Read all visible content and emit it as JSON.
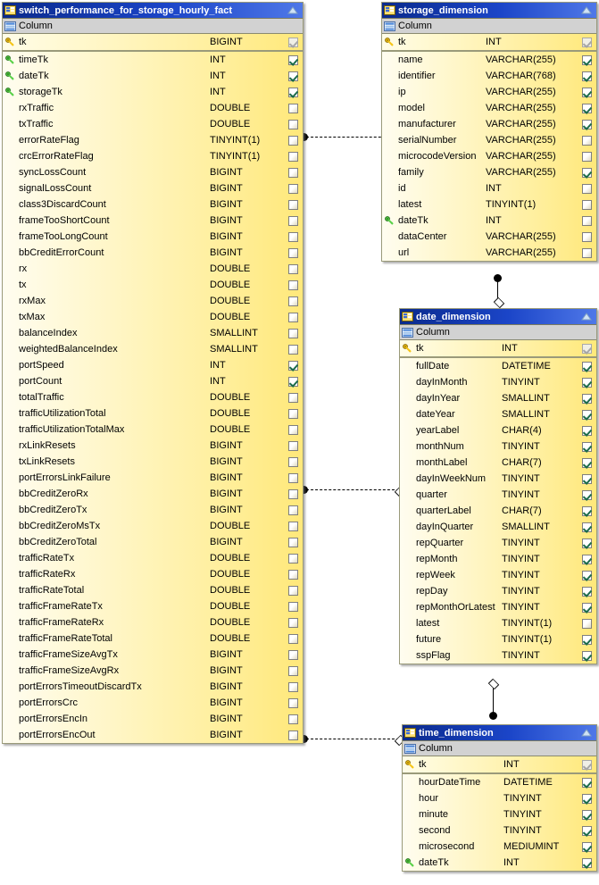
{
  "meta": {
    "column_header": "Column",
    "key_icon_pk": "gold-key-icon",
    "key_icon_fk": "green-key-icon",
    "table_icon": "table-icon",
    "collapse_icon": "collapse-triangle-icon",
    "accent_title": "#1b45c8",
    "row_fill": "#ffef9e",
    "check_color": "#1b6b4a"
  },
  "tables": [
    {
      "id": "fact",
      "name": "switch_performance_for_storage_hourly_fact",
      "pk": {
        "name": "tk",
        "type": "BIGINT",
        "key": "pk",
        "checked": true,
        "disabled": true
      },
      "columns": [
        {
          "name": "timeTk",
          "type": "INT",
          "key": "fk",
          "checked": true
        },
        {
          "name": "dateTk",
          "type": "INT",
          "key": "fk",
          "checked": true
        },
        {
          "name": "storageTk",
          "type": "INT",
          "key": "fk",
          "checked": true
        },
        {
          "name": "rxTraffic",
          "type": "DOUBLE",
          "key": "",
          "checked": false
        },
        {
          "name": "txTraffic",
          "type": "DOUBLE",
          "key": "",
          "checked": false
        },
        {
          "name": "errorRateFlag",
          "type": "TINYINT(1)",
          "key": "",
          "checked": false
        },
        {
          "name": "crcErrorRateFlag",
          "type": "TINYINT(1)",
          "key": "",
          "checked": false
        },
        {
          "name": "syncLossCount",
          "type": "BIGINT",
          "key": "",
          "checked": false
        },
        {
          "name": "signalLossCount",
          "type": "BIGINT",
          "key": "",
          "checked": false
        },
        {
          "name": "class3DiscardCount",
          "type": "BIGINT",
          "key": "",
          "checked": false
        },
        {
          "name": "frameTooShortCount",
          "type": "BIGINT",
          "key": "",
          "checked": false
        },
        {
          "name": "frameTooLongCount",
          "type": "BIGINT",
          "key": "",
          "checked": false
        },
        {
          "name": "bbCreditErrorCount",
          "type": "BIGINT",
          "key": "",
          "checked": false
        },
        {
          "name": "rx",
          "type": "DOUBLE",
          "key": "",
          "checked": false
        },
        {
          "name": "tx",
          "type": "DOUBLE",
          "key": "",
          "checked": false
        },
        {
          "name": "rxMax",
          "type": "DOUBLE",
          "key": "",
          "checked": false
        },
        {
          "name": "txMax",
          "type": "DOUBLE",
          "key": "",
          "checked": false
        },
        {
          "name": "balanceIndex",
          "type": "SMALLINT",
          "key": "",
          "checked": false
        },
        {
          "name": "weightedBalanceIndex",
          "type": "SMALLINT",
          "key": "",
          "checked": false
        },
        {
          "name": "portSpeed",
          "type": "INT",
          "key": "",
          "checked": true
        },
        {
          "name": "portCount",
          "type": "INT",
          "key": "",
          "checked": true
        },
        {
          "name": "totalTraffic",
          "type": "DOUBLE",
          "key": "",
          "checked": false
        },
        {
          "name": "trafficUtilizationTotal",
          "type": "DOUBLE",
          "key": "",
          "checked": false
        },
        {
          "name": "trafficUtilizationTotalMax",
          "type": "DOUBLE",
          "key": "",
          "checked": false
        },
        {
          "name": "rxLinkResets",
          "type": "BIGINT",
          "key": "",
          "checked": false
        },
        {
          "name": "txLinkResets",
          "type": "BIGINT",
          "key": "",
          "checked": false
        },
        {
          "name": "portErrorsLinkFailure",
          "type": "BIGINT",
          "key": "",
          "checked": false
        },
        {
          "name": "bbCreditZeroRx",
          "type": "BIGINT",
          "key": "",
          "checked": false
        },
        {
          "name": "bbCreditZeroTx",
          "type": "BIGINT",
          "key": "",
          "checked": false
        },
        {
          "name": "bbCreditZeroMsTx",
          "type": "DOUBLE",
          "key": "",
          "checked": false
        },
        {
          "name": "bbCreditZeroTotal",
          "type": "BIGINT",
          "key": "",
          "checked": false
        },
        {
          "name": "trafficRateTx",
          "type": "DOUBLE",
          "key": "",
          "checked": false
        },
        {
          "name": "trafficRateRx",
          "type": "DOUBLE",
          "key": "",
          "checked": false
        },
        {
          "name": "trafficRateTotal",
          "type": "DOUBLE",
          "key": "",
          "checked": false
        },
        {
          "name": "trafficFrameRateTx",
          "type": "DOUBLE",
          "key": "",
          "checked": false
        },
        {
          "name": "trafficFrameRateRx",
          "type": "DOUBLE",
          "key": "",
          "checked": false
        },
        {
          "name": "trafficFrameRateTotal",
          "type": "DOUBLE",
          "key": "",
          "checked": false
        },
        {
          "name": "trafficFrameSizeAvgTx",
          "type": "BIGINT",
          "key": "",
          "checked": false
        },
        {
          "name": "trafficFrameSizeAvgRx",
          "type": "BIGINT",
          "key": "",
          "checked": false
        },
        {
          "name": "portErrorsTimeoutDiscardTx",
          "type": "BIGINT",
          "key": "",
          "checked": false
        },
        {
          "name": "portErrorsCrc",
          "type": "BIGINT",
          "key": "",
          "checked": false
        },
        {
          "name": "portErrorsEncIn",
          "type": "BIGINT",
          "key": "",
          "checked": false
        },
        {
          "name": "portErrorsEncOut",
          "type": "BIGINT",
          "key": "",
          "checked": false
        }
      ]
    },
    {
      "id": "storage",
      "name": "storage_dimension",
      "pk": {
        "name": "tk",
        "type": "INT",
        "key": "pk",
        "checked": true,
        "disabled": true
      },
      "columns": [
        {
          "name": "name",
          "type": "VARCHAR(255)",
          "key": "",
          "checked": true
        },
        {
          "name": "identifier",
          "type": "VARCHAR(768)",
          "key": "",
          "checked": true
        },
        {
          "name": "ip",
          "type": "VARCHAR(255)",
          "key": "",
          "checked": true
        },
        {
          "name": "model",
          "type": "VARCHAR(255)",
          "key": "",
          "checked": true
        },
        {
          "name": "manufacturer",
          "type": "VARCHAR(255)",
          "key": "",
          "checked": true
        },
        {
          "name": "serialNumber",
          "type": "VARCHAR(255)",
          "key": "",
          "checked": false
        },
        {
          "name": "microcodeVersion",
          "type": "VARCHAR(255)",
          "key": "",
          "checked": false
        },
        {
          "name": "family",
          "type": "VARCHAR(255)",
          "key": "",
          "checked": true
        },
        {
          "name": "id",
          "type": "INT",
          "key": "",
          "checked": false
        },
        {
          "name": "latest",
          "type": "TINYINT(1)",
          "key": "",
          "checked": false
        },
        {
          "name": "dateTk",
          "type": "INT",
          "key": "fk",
          "checked": false
        },
        {
          "name": "dataCenter",
          "type": "VARCHAR(255)",
          "key": "",
          "checked": false
        },
        {
          "name": "url",
          "type": "VARCHAR(255)",
          "key": "",
          "checked": false
        }
      ]
    },
    {
      "id": "date",
      "name": "date_dimension",
      "pk": {
        "name": "tk",
        "type": "INT",
        "key": "pk",
        "checked": true,
        "disabled": true
      },
      "columns": [
        {
          "name": "fullDate",
          "type": "DATETIME",
          "key": "",
          "checked": true
        },
        {
          "name": "dayInMonth",
          "type": "TINYINT",
          "key": "",
          "checked": true
        },
        {
          "name": "dayInYear",
          "type": "SMALLINT",
          "key": "",
          "checked": true
        },
        {
          "name": "dateYear",
          "type": "SMALLINT",
          "key": "",
          "checked": true
        },
        {
          "name": "yearLabel",
          "type": "CHAR(4)",
          "key": "",
          "checked": true
        },
        {
          "name": "monthNum",
          "type": "TINYINT",
          "key": "",
          "checked": true
        },
        {
          "name": "monthLabel",
          "type": "CHAR(7)",
          "key": "",
          "checked": true
        },
        {
          "name": "dayInWeekNum",
          "type": "TINYINT",
          "key": "",
          "checked": true
        },
        {
          "name": "quarter",
          "type": "TINYINT",
          "key": "",
          "checked": true
        },
        {
          "name": "quarterLabel",
          "type": "CHAR(7)",
          "key": "",
          "checked": true
        },
        {
          "name": "dayInQuarter",
          "type": "SMALLINT",
          "key": "",
          "checked": true
        },
        {
          "name": "repQuarter",
          "type": "TINYINT",
          "key": "",
          "checked": true
        },
        {
          "name": "repMonth",
          "type": "TINYINT",
          "key": "",
          "checked": true
        },
        {
          "name": "repWeek",
          "type": "TINYINT",
          "key": "",
          "checked": true
        },
        {
          "name": "repDay",
          "type": "TINYINT",
          "key": "",
          "checked": true
        },
        {
          "name": "repMonthOrLatest",
          "type": "TINYINT",
          "key": "",
          "checked": true
        },
        {
          "name": "latest",
          "type": "TINYINT(1)",
          "key": "",
          "checked": false
        },
        {
          "name": "future",
          "type": "TINYINT(1)",
          "key": "",
          "checked": true
        },
        {
          "name": "sspFlag",
          "type": "TINYINT",
          "key": "",
          "checked": true
        }
      ]
    },
    {
      "id": "time",
      "name": "time_dimension",
      "pk": {
        "name": "tk",
        "type": "INT",
        "key": "pk",
        "checked": true,
        "disabled": true
      },
      "columns": [
        {
          "name": "hourDateTime",
          "type": "DATETIME",
          "key": "",
          "checked": true
        },
        {
          "name": "hour",
          "type": "TINYINT",
          "key": "",
          "checked": true
        },
        {
          "name": "minute",
          "type": "TINYINT",
          "key": "",
          "checked": true
        },
        {
          "name": "second",
          "type": "TINYINT",
          "key": "",
          "checked": true
        },
        {
          "name": "microsecond",
          "type": "MEDIUMINT",
          "key": "",
          "checked": true
        },
        {
          "name": "dateTk",
          "type": "INT",
          "key": "fk",
          "checked": true
        }
      ]
    }
  ],
  "relationships": [
    {
      "from": "fact",
      "to": "storage",
      "style": "dashed",
      "from_end": "dot",
      "to_end": "diamond"
    },
    {
      "from": "fact",
      "to": "date",
      "style": "dashed",
      "from_end": "dot",
      "to_end": "diamond"
    },
    {
      "from": "fact",
      "to": "time",
      "style": "dashed",
      "from_end": "dot",
      "to_end": "diamond"
    },
    {
      "from": "storage",
      "to": "date",
      "style": "solid",
      "from_end": "dot",
      "to_end": "diamond"
    },
    {
      "from": "date",
      "to": "time",
      "style": "solid",
      "from_end": "diamond",
      "to_end": "dot"
    }
  ]
}
